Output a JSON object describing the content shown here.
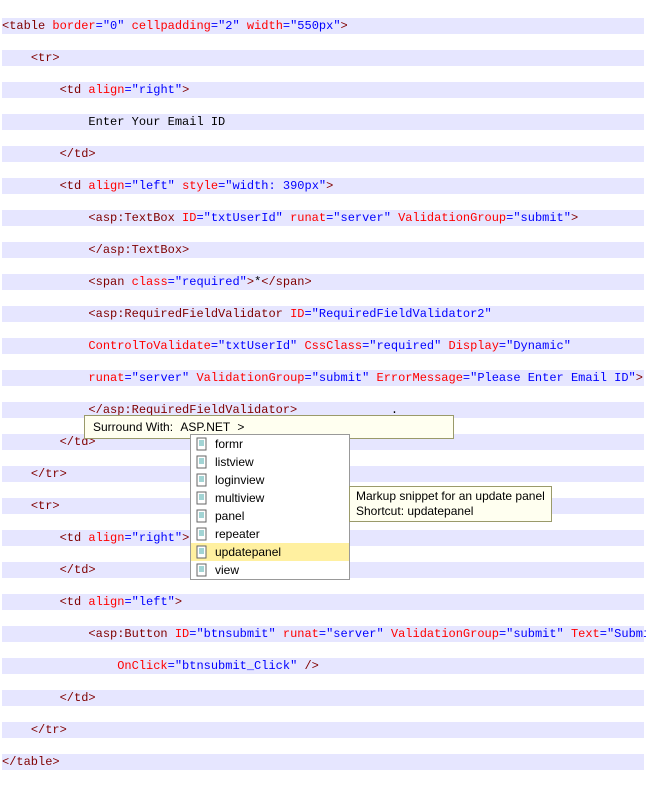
{
  "code": {
    "l1_open": "<table",
    "l1_a1": "border",
    "l1_v1": "\"0\"",
    "l1_a2": "cellpadding",
    "l1_v2": "\"2\"",
    "l1_a3": "width",
    "l1_v3": "\"550px\"",
    "l1_close": ">",
    "l2": "<tr>",
    "l3_open": "<td",
    "l3_a1": "align",
    "l3_v1": "\"right\"",
    "l3_close": ">",
    "l4_text": "Enter Your Email ID",
    "l5": "</td>",
    "l6_open": "<td",
    "l6_a1": "align",
    "l6_v1": "\"left\"",
    "l6_a2": "style",
    "l6_v2": "\"width: 390px\"",
    "l6_close": ">",
    "l7_open": "<asp:TextBox",
    "l7_a1": "ID",
    "l7_v1": "\"txtUserId\"",
    "l7_a2": "runat",
    "l7_v2": "\"server\"",
    "l7_a3": "ValidationGroup",
    "l7_v3": "\"submit\"",
    "l7_close": ">",
    "l8": "</asp:TextBox>",
    "l9_open": "<span",
    "l9_a1": "class",
    "l9_v1": "\"required\"",
    "l9_close": ">",
    "l9_star": "*",
    "l9_end": "</span>",
    "l10_open": "<asp:RequiredFieldValidator",
    "l10_a1": "ID",
    "l10_v1": "\"RequiredFieldValidator2\"",
    "l11_a1": "ControlToValidate",
    "l11_v1": "\"txtUserId\"",
    "l11_a2": "CssClass",
    "l11_v2": "\"required\"",
    "l11_a3": "Display",
    "l11_v3": "\"Dynamic\"",
    "l12_a1": "runat",
    "l12_v1": "\"server\"",
    "l12_a2": "ValidationGroup",
    "l12_v2": "\"submit\"",
    "l12_a3": "ErrorMessage",
    "l12_v3": "\"Please Enter Email ID\"",
    "l12_close": ">",
    "l13": "</asp:RequiredFieldValidator>",
    "l14": "</td>",
    "l15": "</tr>",
    "l16": "<tr>",
    "l17_open": "<td",
    "l17_a1": "align",
    "l17_v1": "\"right\"",
    "l17_close": ">",
    "l18": "</td>",
    "l19_open": "<td",
    "l19_a1": "align",
    "l19_v1": "\"left\"",
    "l19_close": ">",
    "l20_open": "<asp:Button",
    "l20_a1": "ID",
    "l20_v1": "\"btnsubmit\"",
    "l20_a2": "runat",
    "l20_v2": "\"server\"",
    "l20_a3": "ValidationGroup",
    "l20_v3": "\"submit\"",
    "l20_a4": "Text",
    "l20_v4": "\"Submit\"",
    "l21_a1": "OnClick",
    "l21_v1": "\"btnsubmit_Click\"",
    "l21_close": "/>",
    "l22": "</td>",
    "l23": "</tr>",
    "l24": "</table>",
    "dot": "."
  },
  "popup": {
    "label": "Surround With:",
    "path": "ASP.NET",
    "arrow": ">"
  },
  "dropdown": {
    "items": [
      {
        "label": "formr"
      },
      {
        "label": "listview"
      },
      {
        "label": "loginview"
      },
      {
        "label": "multiview"
      },
      {
        "label": "panel"
      },
      {
        "label": "repeater"
      },
      {
        "label": "updatepanel"
      },
      {
        "label": "view"
      }
    ]
  },
  "tooltip": {
    "line1": "Markup snippet for an update panel",
    "line2": "Shortcut: updatepanel"
  }
}
